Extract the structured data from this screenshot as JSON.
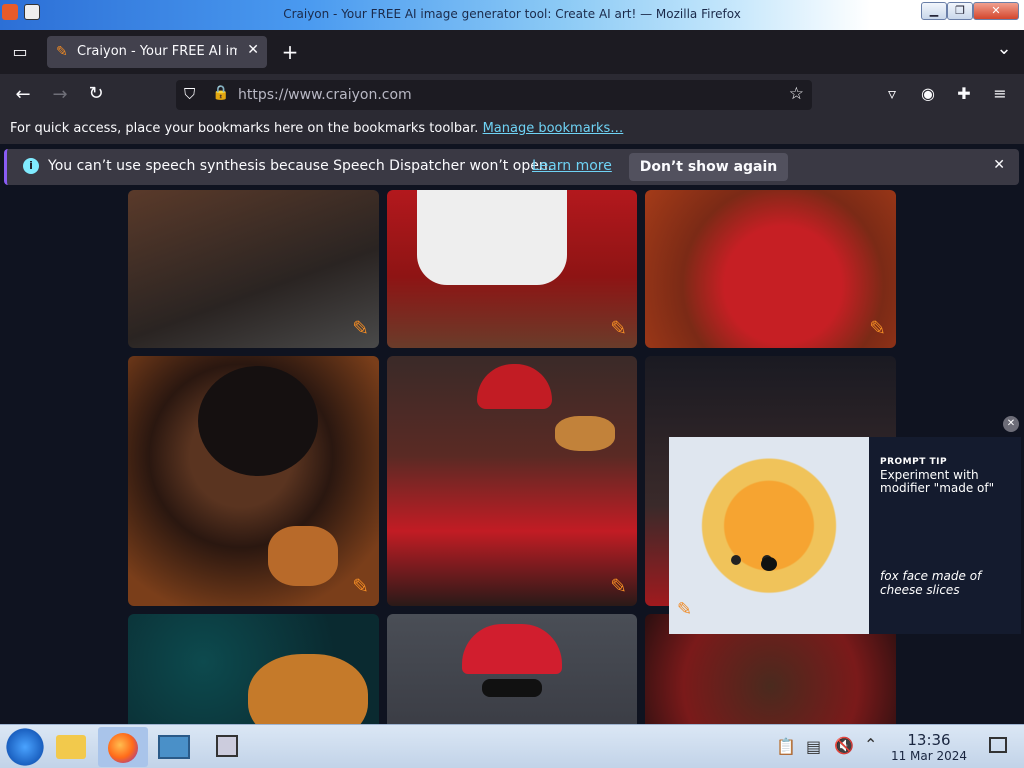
{
  "window": {
    "title": "Craiyon - Your FREE AI image generator tool: Create AI art! — Mozilla Firefox",
    "controls": [
      "▁",
      "❐",
      "✕"
    ]
  },
  "tabs": [
    {
      "label": "Craiyon - Your FREE AI image generator tool",
      "active": true,
      "close": "✕"
    }
  ],
  "tabbar": {
    "new_tab": "+",
    "list_all": "⌄",
    "view_recent": "▭"
  },
  "nav": {
    "back": "←",
    "forward": "→",
    "reload": "↻",
    "url": "https://www.craiyon.com",
    "bookmark_star": "☆",
    "toolbar_icons": [
      "pocket-icon",
      "account-icon",
      "extensions-icon",
      "menu-icon"
    ]
  },
  "bookmarks": {
    "message": "For quick access, place your bookmarks here on the bookmarks toolbar.",
    "manage_link": "Manage bookmarks…"
  },
  "notification": {
    "message": "You can’t use speech synthesis because Speech Dispatcher won’t open.",
    "learn_more": "Learn more",
    "dont_show": "Don’t show again",
    "close": "✕"
  },
  "gallery": {
    "edit_icon": "✎",
    "images": [
      {
        "name": "man eating chicken dark sweater"
      },
      {
        "name": "man white shirt table red background"
      },
      {
        "name": "man red hoodie eating"
      },
      {
        "name": "man laughing holding fried chicken"
      },
      {
        "name": "man red beanie sunglasses eating chicken"
      },
      {
        "name": "man glasses red background"
      },
      {
        "name": "fried chicken sandwich teal background"
      },
      {
        "name": "man red cap sunglasses"
      },
      {
        "name": "man portrait red background"
      }
    ]
  },
  "ad": {
    "label": "PROMPT TIP",
    "text": "Experiment with modifier \"made of\"",
    "caption": "fox face made of cheese slices",
    "close": "✕"
  },
  "taskbar": {
    "time": "13:36",
    "date": "11 Mar 2024",
    "apps": [
      "start-menu",
      "file-manager",
      "firefox",
      "system-monitor",
      "window-switcher"
    ]
  }
}
